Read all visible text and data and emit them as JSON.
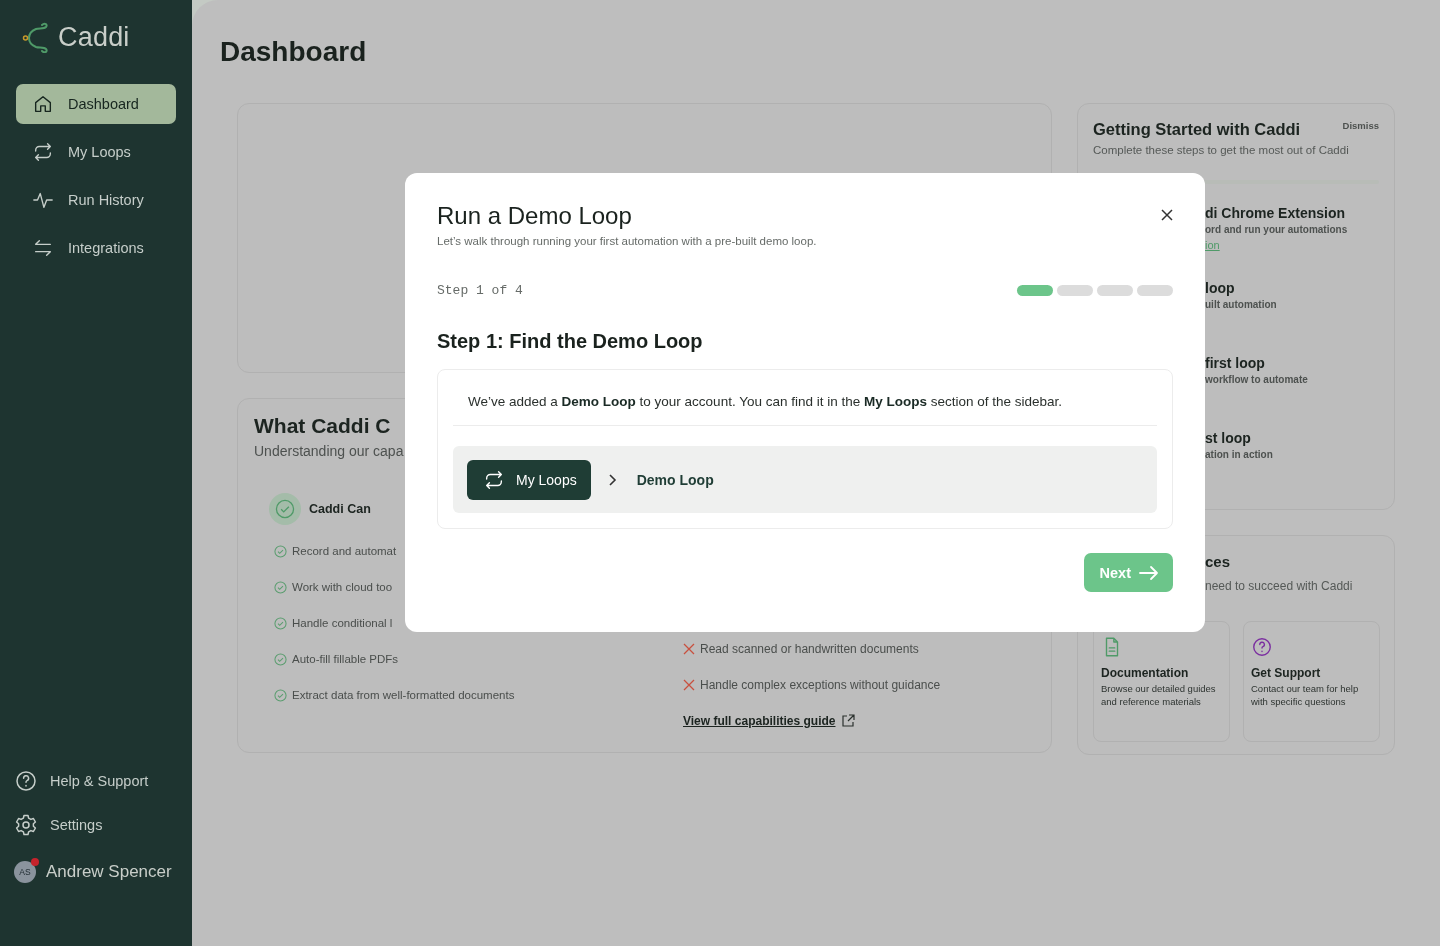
{
  "sidebar": {
    "logo": "Caddi",
    "nav": [
      {
        "label": "Dashboard",
        "selected": true
      },
      {
        "label": "My Loops",
        "selected": false
      },
      {
        "label": "Run History",
        "selected": false
      },
      {
        "label": "Integrations",
        "selected": false
      }
    ],
    "footer": [
      {
        "label": "Help & Support"
      },
      {
        "label": "Settings"
      }
    ],
    "user": {
      "initials": "AS",
      "name": "Andrew Spencer",
      "notification": true
    }
  },
  "page": {
    "title": "Dashboard"
  },
  "capabilities": {
    "title": "What Caddi C",
    "subtitle": "Understanding our capa",
    "can": {
      "heading": "Caddi Can",
      "items": [
        "Record and automat",
        "Work with cloud too",
        "Handle conditional l",
        "Auto-fill fillable PDFs",
        "Extract data from well-formatted documents"
      ]
    },
    "cannot": {
      "items": [
        "Read scanned or handwritten documents",
        "Handle complex exceptions without guidance"
      ]
    },
    "link": "View full capabilities guide"
  },
  "getting_started": {
    "title": "Getting Started with Caddi",
    "dismiss": "Dismiss",
    "subtitle": "Complete these steps to get the most out of Caddi",
    "steps": [
      {
        "title": "di Chrome Extension",
        "description": "ord and run your automations",
        "link": "ion"
      },
      {
        "title": "loop",
        "description": "uilt automation"
      },
      {
        "title": "first loop",
        "description": "workflow to automate"
      },
      {
        "title": "st loop",
        "description": "ation in action"
      }
    ]
  },
  "resources": {
    "title": "ces",
    "subtitle": "need to succeed with Caddi",
    "items": [
      {
        "title": "Documentation",
        "description": "Browse our detailed guides and reference materials",
        "color": "#4f9a68"
      },
      {
        "title": "Get Support",
        "description": "Contact our team for help with specific questions",
        "color": "#7b2fa0"
      }
    ]
  },
  "modal": {
    "title": "Run a Demo Loop",
    "subtitle": "Let’s walk through running your first automation with a pre-built demo loop.",
    "step_label": "Step 1 of 4",
    "steps": [
      {
        "active": true
      },
      {
        "active": false
      },
      {
        "active": false
      },
      {
        "active": false
      }
    ],
    "heading": "Step 1: Find the Demo Loop",
    "message": "We’ve added a **Demo Loop** to your account. You can find it in the **My Loops** section of the sidebar.",
    "breadcrumb": {
      "button": "My Loops",
      "current": "Demo Loop"
    },
    "next": "Next"
  }
}
